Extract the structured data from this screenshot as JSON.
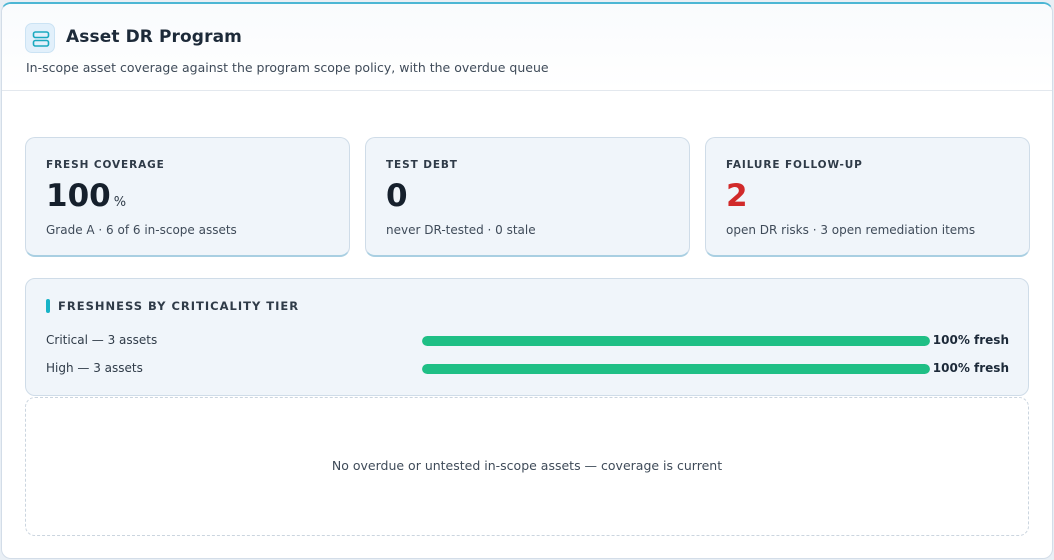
{
  "header": {
    "title": "Asset DR Program",
    "subtitle": "In-scope asset coverage against the program scope policy, with the overdue queue",
    "icon": "server-stack-icon"
  },
  "kpis": [
    {
      "label": "FRESH COVERAGE",
      "value": "100",
      "unit": "%",
      "sub": "Grade A · 6 of 6 in-scope assets"
    },
    {
      "label": "TEST DEBT",
      "value": "0",
      "sub": "never DR-tested · 0 stale"
    },
    {
      "label": "FAILURE FOLLOW-UP",
      "value": "2",
      "sub": "open DR risks · 3 open remediation items",
      "color": "#d12a2a"
    }
  ],
  "tiers": {
    "title": "FRESHNESS BY CRITICALITY TIER",
    "rows": [
      {
        "label": "Critical — 3 assets",
        "pct_label": "100% fresh",
        "fraction": 1.0
      },
      {
        "label": "High — 3 assets",
        "pct_label": "100% fresh",
        "fraction": 1.0
      }
    ]
  },
  "queue": {
    "empty_message": "No overdue or untested in-scope assets — coverage is current"
  },
  "colors": {
    "accent": "#17b3c7",
    "fresh": "#1fbf85",
    "alert": "#d12a2a"
  }
}
